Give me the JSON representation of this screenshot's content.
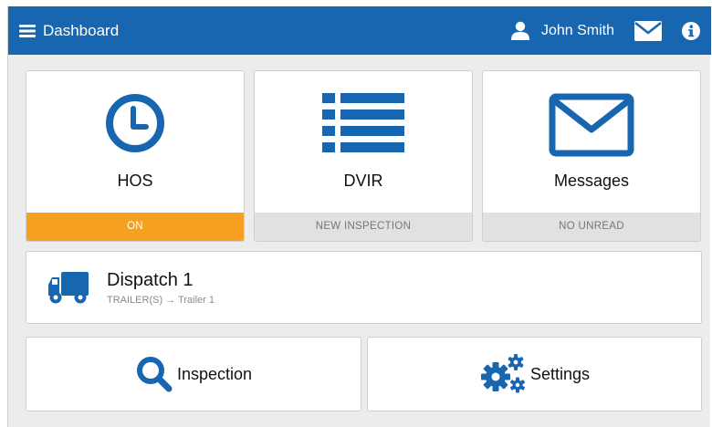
{
  "header": {
    "title": "Dashboard",
    "user_name": "John Smith",
    "menu_icon": "hamburger-icon",
    "user_icon": "user-icon",
    "mail_icon": "envelope-icon",
    "info_icon": "info-icon",
    "bar_color": "#1966b0"
  },
  "tiles": [
    {
      "label": "HOS",
      "status": "ON",
      "icon": "clock-icon",
      "status_color": "#f5a020"
    },
    {
      "label": "DVIR",
      "status": "NEW INSPECTION",
      "icon": "list-icon",
      "status_color": "#e1e1e1"
    },
    {
      "label": "Messages",
      "status": "NO UNREAD",
      "icon": "envelope-icon",
      "status_color": "#e1e1e1"
    }
  ],
  "dispatch": {
    "title": "Dispatch 1",
    "subtitle": "TRAILER(S) → Trailer 1",
    "icon": "truck-icon"
  },
  "actions": [
    {
      "label": "Inspection",
      "icon": "search-icon"
    },
    {
      "label": "Settings",
      "icon": "gears-icon"
    }
  ],
  "accent_color": "#1966b0"
}
